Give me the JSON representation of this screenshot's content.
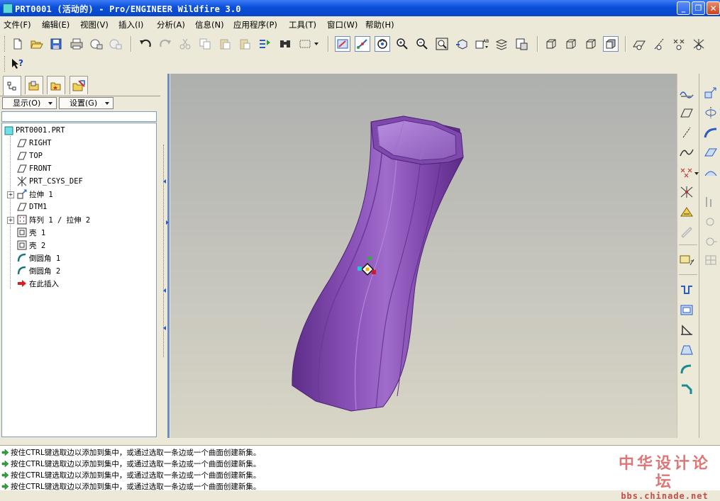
{
  "window": {
    "title": "PRT0001 (活动的) - Pro/ENGINEER Wildfire 3.0",
    "minimize": "_",
    "maximize": "❐",
    "close": "✕"
  },
  "menu": [
    "文件(F)",
    "编辑(E)",
    "视图(V)",
    "插入(I)",
    "分析(A)",
    "信息(N)",
    "应用程序(P)",
    "工具(T)",
    "窗口(W)",
    "帮助(H)"
  ],
  "left_panel": {
    "show_button": "显示(O)",
    "settings_button": "设置(G)",
    "tree": [
      {
        "label": "PRT0001.PRT",
        "icon": "part-icon",
        "level": 0,
        "expandable": false
      },
      {
        "label": "RIGHT",
        "icon": "datum-plane-icon",
        "level": 1,
        "expandable": false
      },
      {
        "label": "TOP",
        "icon": "datum-plane-icon",
        "level": 1,
        "expandable": false
      },
      {
        "label": "FRONT",
        "icon": "datum-plane-icon",
        "level": 1,
        "expandable": false
      },
      {
        "label": "PRT_CSYS_DEF",
        "icon": "csys-icon",
        "level": 1,
        "expandable": false
      },
      {
        "label": "拉伸 1",
        "icon": "extrude-icon",
        "level": 1,
        "expandable": true
      },
      {
        "label": "DTM1",
        "icon": "datum-plane-icon",
        "level": 1,
        "expandable": false
      },
      {
        "label": "阵列 1 / 拉伸 2",
        "icon": "pattern-icon",
        "level": 1,
        "expandable": true
      },
      {
        "label": "壳 1",
        "icon": "shell-icon",
        "level": 1,
        "expandable": false
      },
      {
        "label": "壳 2",
        "icon": "shell-icon",
        "level": 1,
        "expandable": false
      },
      {
        "label": "倒圆角 1",
        "icon": "round-icon",
        "level": 1,
        "expandable": false
      },
      {
        "label": "倒圆角 2",
        "icon": "round-icon",
        "level": 1,
        "expandable": false
      },
      {
        "label": "在此插入",
        "icon": "insert-here-icon",
        "level": 1,
        "expandable": false
      }
    ]
  },
  "messages": [
    "按住CTRL键选取边以添加到集中，或通过选取一条边或一个曲面创建新集。",
    "按住CTRL键选取边以添加到集中，或通过选取一条边或一个曲面创建新集。",
    "按住CTRL键选取边以添加到集中，或通过选取一条边或一个曲面创建新集。",
    "按住CTRL键选取边以添加到集中，或通过选取一条边或一个曲面创建新集。"
  ],
  "watermark": {
    "line1": "中华设计论坛",
    "line2": "bbs.chinade.net"
  },
  "colors": {
    "model": "#8a52b8",
    "titlebar": "#0a4fd9",
    "message_arrow": "#2fa43a"
  }
}
